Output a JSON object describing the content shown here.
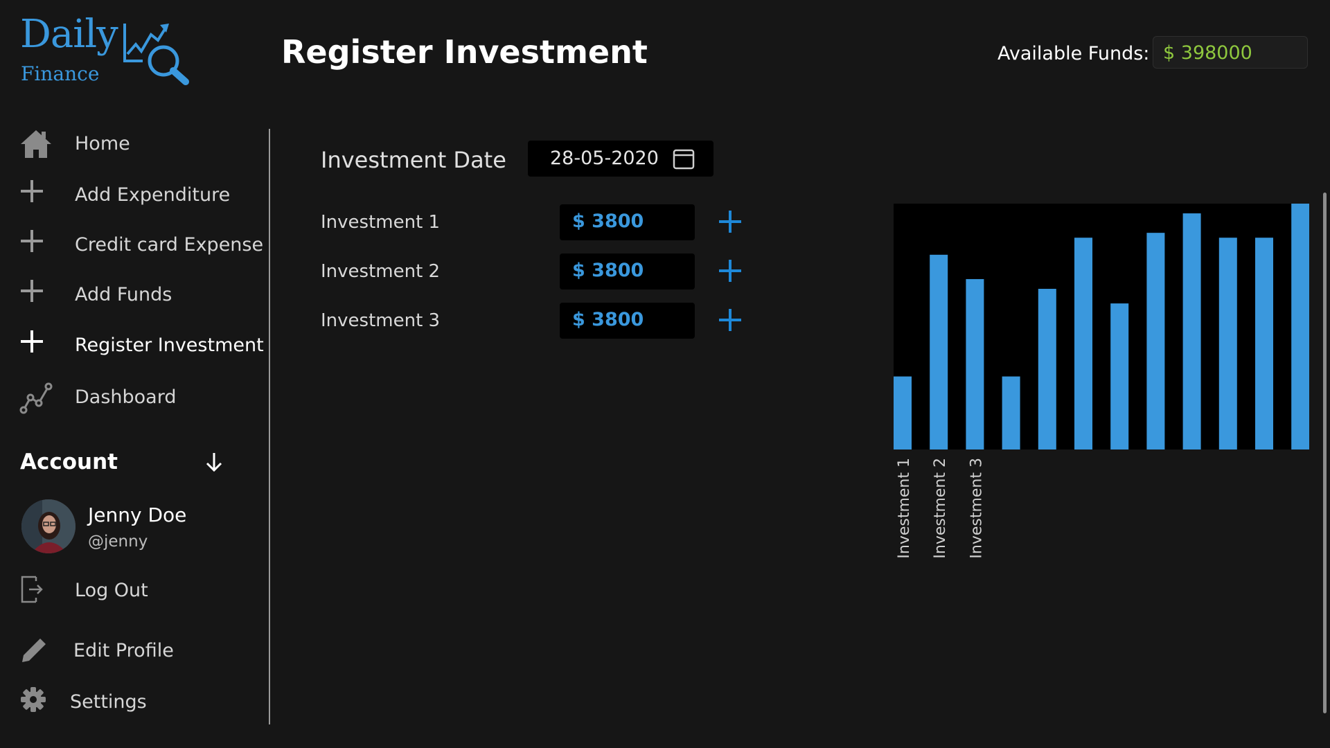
{
  "logo": {
    "primary": "Daily",
    "secondary": "Finance"
  },
  "header": {
    "title": "Register Investment",
    "funds_label": "Available Funds:",
    "funds_value": "$ 398000",
    "funds_color": "#8fc83e"
  },
  "sidebar": {
    "items": [
      {
        "label": "Home",
        "icon": "home-icon"
      },
      {
        "label": "Add Expenditure",
        "icon": "plus-icon"
      },
      {
        "label": "Credit card Expense",
        "icon": "plus-icon"
      },
      {
        "label": "Add Funds",
        "icon": "plus-icon"
      },
      {
        "label": "Register Investment",
        "icon": "plus-icon",
        "active": true
      },
      {
        "label": "Dashboard",
        "icon": "line-chart-icon"
      }
    ],
    "account": {
      "heading": "Account",
      "user_name": "Jenny Doe",
      "user_handle": "@jenny",
      "logout": "Log Out",
      "edit_profile": "Edit Profile",
      "settings": "Settings"
    }
  },
  "form": {
    "date_label": "Investment Date",
    "date_value": "28-05-2020",
    "investments": [
      {
        "label": "Investment 1",
        "value": "$ 3800"
      },
      {
        "label": "Investment 2",
        "value": "$ 3800"
      },
      {
        "label": "Investment 3",
        "value": "$ 3800"
      }
    ]
  },
  "colors": {
    "accent": "#3a98dd",
    "background": "#161616",
    "field": "#000000"
  },
  "chart_data": {
    "type": "bar",
    "categories": [
      "Investment 1",
      "Investment 2",
      "Investment 3",
      "",
      "",
      "",
      "",
      "",
      "",
      "",
      "",
      ""
    ],
    "values": [
      30,
      80,
      70,
      30,
      66,
      87,
      60,
      89,
      97,
      87,
      87,
      101
    ],
    "ylim": [
      0,
      101
    ],
    "bar_color": "#3a98dd",
    "plot_background": "#000000",
    "grid": false
  }
}
